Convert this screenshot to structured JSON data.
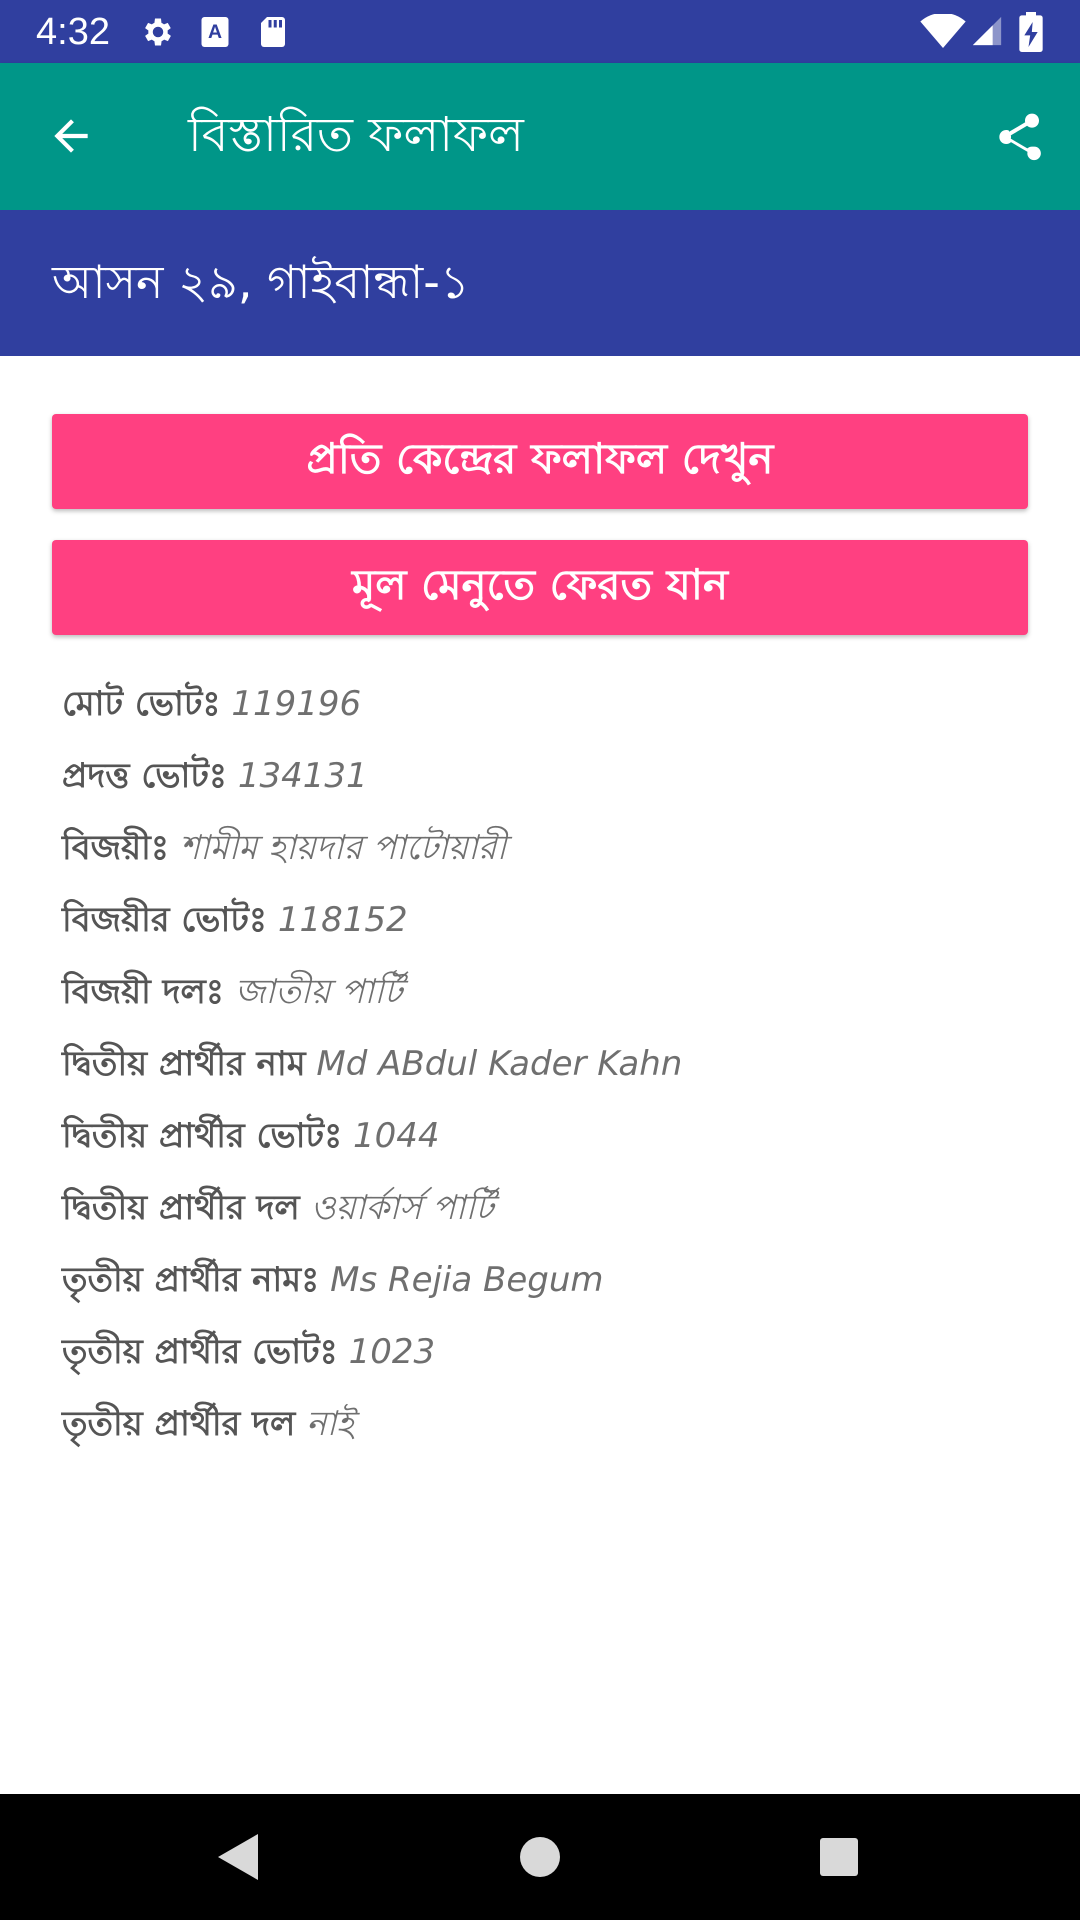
{
  "status_bar": {
    "time": "4:32",
    "left_icons": [
      "settings-icon",
      "font-a-icon",
      "sd-card-icon"
    ],
    "right_icons": [
      "wifi-icon",
      "cellular-signal-icon",
      "battery-charging-icon"
    ]
  },
  "app_bar": {
    "back_icon": "arrow-back-icon",
    "title": "বিস্তারিত ফলাফল",
    "share_icon": "share-icon"
  },
  "seat_header": {
    "text": "আসন ২৯, গাইবান্ধা-১"
  },
  "buttons": {
    "center_results": "প্রতি কেন্দ্রের ফলাফল দেখুন",
    "main_menu": "মূল মেনুতে ফেরত যান"
  },
  "details": [
    {
      "label": "মোট ভোটঃ",
      "value": "119196"
    },
    {
      "label": "প্রদত্ত ভোটঃ",
      "value": "134131"
    },
    {
      "label": "বিজয়ীঃ",
      "value": "শামীম হায়দার পাটোয়ারী"
    },
    {
      "label": "বিজয়ীর ভোটঃ",
      "value": "118152"
    },
    {
      "label": "বিজয়ী দলঃ",
      "value": "জাতীয় পার্টি"
    },
    {
      "label": "দ্বিতীয় প্রার্থীর নাম",
      "value": "Md ABdul Kader Kahn"
    },
    {
      "label": "দ্বিতীয় প্রার্থীর ভোটঃ",
      "value": "1044"
    },
    {
      "label": "দ্বিতীয় প্রার্থীর দল",
      "value": "ওয়ার্কার্স পার্টি"
    },
    {
      "label": "তৃতীয় প্রার্থীর নামঃ",
      "value": "Ms Rejia Begum"
    },
    {
      "label": "তৃতীয় প্রার্থীর ভোটঃ",
      "value": "1023"
    },
    {
      "label": "তৃতীয় প্রার্থীর দল",
      "value": "নাই"
    }
  ],
  "nav_bar": {
    "icons": [
      "nav-back-icon",
      "nav-home-icon",
      "nav-recents-icon"
    ]
  },
  "colors": {
    "status_bar": "#303F9F",
    "app_bar": "#009688",
    "seat_bar": "#303F9F",
    "button": "#FF4081",
    "nav_bar": "#000000"
  }
}
